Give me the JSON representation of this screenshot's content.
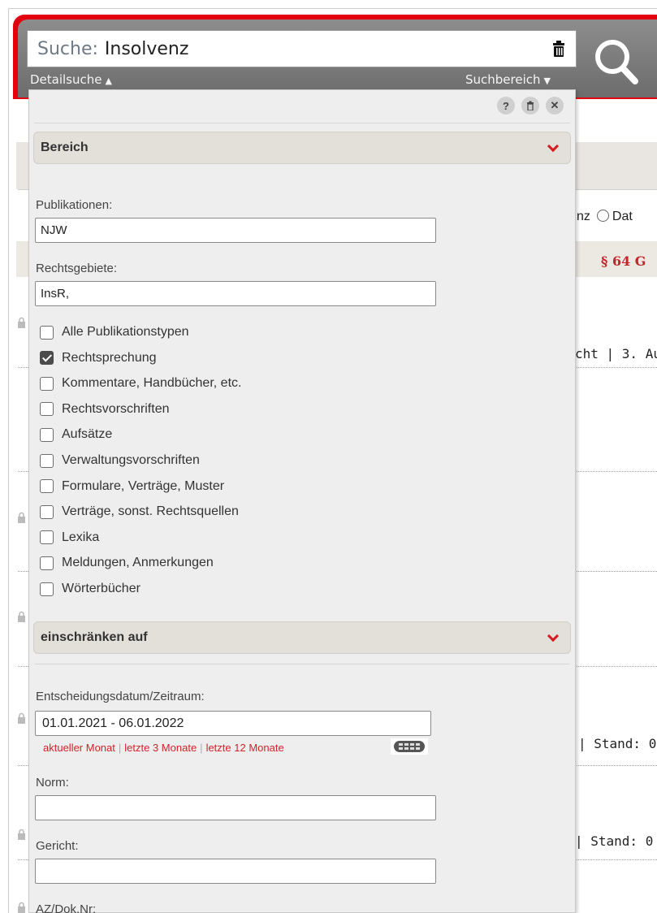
{
  "search": {
    "prefix": "Suche:",
    "value": "Insolvenz",
    "detail_link": "Detailsuche",
    "scope_link": "Suchbereich"
  },
  "background": {
    "radio_fragment": "nz",
    "radio_label": "Dat",
    "norm_fragment": "§ 64 G",
    "result1_fragment": "cht | 3. Au",
    "result2_fragment": "| Stand: 0",
    "result3_fragment": "| Stand: 0"
  },
  "panel": {
    "section_area": "Bereich",
    "section_restrict": "einschränken auf",
    "publications_label": "Publikationen:",
    "publications_value": "NJW",
    "fields_label": "Rechtsgebiete:",
    "fields_value": "InsR,",
    "types": [
      {
        "label": "Alle Publikationstypen",
        "checked": false
      },
      {
        "label": "Rechtsprechung",
        "checked": true
      },
      {
        "label": "Kommentare, Handbücher, etc.",
        "checked": false
      },
      {
        "label": "Rechtsvorschriften",
        "checked": false
      },
      {
        "label": "Aufsätze",
        "checked": false
      },
      {
        "label": "Verwaltungsvorschriften",
        "checked": false
      },
      {
        "label": "Formulare, Verträge, Muster",
        "checked": false
      },
      {
        "label": "Verträge, sonst. Rechtsquellen",
        "checked": false
      },
      {
        "label": "Lexika",
        "checked": false
      },
      {
        "label": "Meldungen, Anmerkungen",
        "checked": false
      },
      {
        "label": "Wörterbücher",
        "checked": false
      }
    ],
    "date_label": "Entscheidungsdatum/Zeitraum:",
    "date_value": "01.01.2021 - 06.01.2022",
    "quick_current": "aktueller Monat",
    "quick_3": "letzte 3 Monate",
    "quick_12": "letzte 12 Monate",
    "norm_label": "Norm:",
    "court_label": "Gericht:",
    "docnr_label": "AZ/Dok.Nr:"
  },
  "colors": {
    "brand_red": "#e3000f",
    "link_red": "#d2222a"
  }
}
